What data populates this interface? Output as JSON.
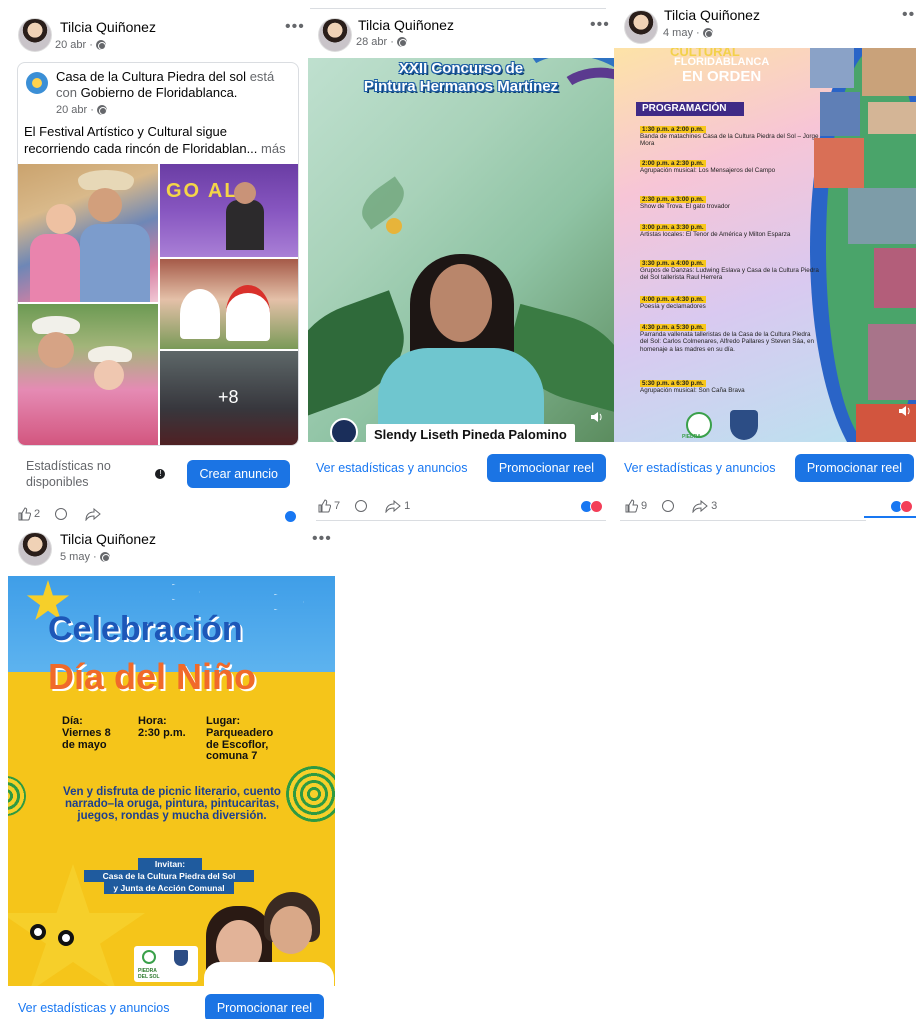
{
  "colors": {
    "accent": "#1b74e4",
    "link": "#1877f2",
    "muted": "#65676b",
    "divider": "#dadde1"
  },
  "posts": [
    {
      "author": "Tilcia Quiñonez",
      "date": "20 abr",
      "shared": {
        "page": "Casa de la Cultura Piedra del sol",
        "connector": "está con",
        "with": "Gobierno de Floridablanca.",
        "date": "20 abr",
        "text": "El Festival Artístico y Cultural sigue recorriendo cada rincón de Floridablan...",
        "more": "más",
        "photo_overflow": "+8",
        "banner_text": "GO AL"
      },
      "stats_label": "Estadísticas no disponibles",
      "cta": "Crear anuncio",
      "likes": "2"
    },
    {
      "author": "Tilcia Quiñonez",
      "date": "28 abr",
      "title_line1": "XXII Concurso de",
      "title_line2": "Pintura Hermanos Martínez",
      "person_name": "Slendy Liseth Pineda Palomino",
      "stats_label": "Ver estadísticas y anuncios",
      "cta": "Promocionar reel",
      "likes": "7",
      "shares": "1"
    },
    {
      "author": "Tilcia Quiñonez",
      "date": "4 may",
      "header_lines": [
        "CULTURAL",
        "FLORIDABLANCA",
        "EN ORDEN"
      ],
      "program_title": "PROGRAMACIÓN",
      "program": [
        {
          "time": "1:30 p.m. a 2:00 p.m.",
          "desc": "Banda de matachines Casa de la Cultura Piedra del Sol – Jorge Mora"
        },
        {
          "time": "2:00 p.m. a 2:30 p.m.",
          "desc": "Agrupación musical: Los Mensajeros del Campo"
        },
        {
          "time": "2:30 p.m. a 3:00 p.m.",
          "desc": "Show de Trova. El gato trovador"
        },
        {
          "time": "3:00 p.m. a 3:30 p.m.",
          "desc": "Artistas locales: El Tenor de América y Milton Esparza"
        },
        {
          "time": "3:30 p.m. a 4:00 p.m.",
          "desc": "Grupos de Danzas: Ludwing Eslava y Casa de la Cultura Piedra del Sol tallerista Raul Herrera"
        },
        {
          "time": "4:00 p.m. a 4:30 p.m.",
          "desc": "Poesía y declamadores"
        },
        {
          "time": "4:30 p.m. a 5:30 p.m.",
          "desc": "Parranda vallenata talleristas de la Casa de la Cultura Piedra del Sol: Carlos Colmenares, Alfredo Pallares y Steven Sáa, en homenaje a las madres en su día."
        },
        {
          "time": "5:30 p.m. a 6:30 p.m.",
          "desc": "Agrupación musical: Son Caña Brava"
        }
      ],
      "logo_text": "PIEDRA",
      "stats_label": "Ver estadísticas y anuncios",
      "cta": "Promocionar reel",
      "likes": "9",
      "shares": "3"
    },
    {
      "author": "Tilcia Quiñonez",
      "date": "5 may",
      "title_line1": "Celebración",
      "title_line2": "Día del Niño",
      "dia_label": "Día:",
      "dia_value": "Viernes 8 de mayo",
      "hora_label": "Hora:",
      "hora_value": "2:30 p.m.",
      "lugar_label": "Lugar:",
      "lugar_value": "Parqueadero de Escoflor, comuna 7",
      "invite_text": "Ven y disfruta de picnic literario, cuento narrado–la oruga, pintura, pintucaritas, juegos, rondas y mucha diversión.",
      "invitan_label": "Invitan:",
      "invitan_line1": "Casa de la Cultura Piedra del Sol",
      "invitan_line2": "y Junta de Acción Comunal",
      "logo_text": "PIEDRA DEL SOL",
      "stats_label": "Ver estadísticas y anuncios",
      "cta": "Promocionar reel"
    }
  ]
}
